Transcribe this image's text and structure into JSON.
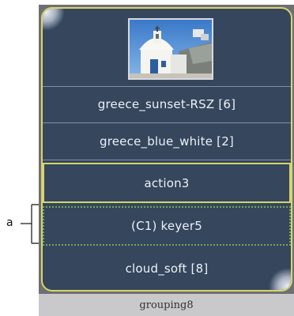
{
  "callout": {
    "label": "a"
  },
  "thumbnail": {
    "icon": "church-photo-thumbnail"
  },
  "items": [
    {
      "label": "greece_sunset-RSZ [6]"
    },
    {
      "label": "greece_blue_white [2]"
    },
    {
      "label": "action3"
    },
    {
      "label": "(C1) keyer5"
    },
    {
      "label": "cloud_soft [8]"
    }
  ],
  "footer": {
    "label": "grouping8"
  },
  "colors": {
    "panel": "#35465d",
    "selection": "#d8d46a",
    "keyer_outline": "#6fa85a",
    "footer": "#c9c9cb"
  }
}
